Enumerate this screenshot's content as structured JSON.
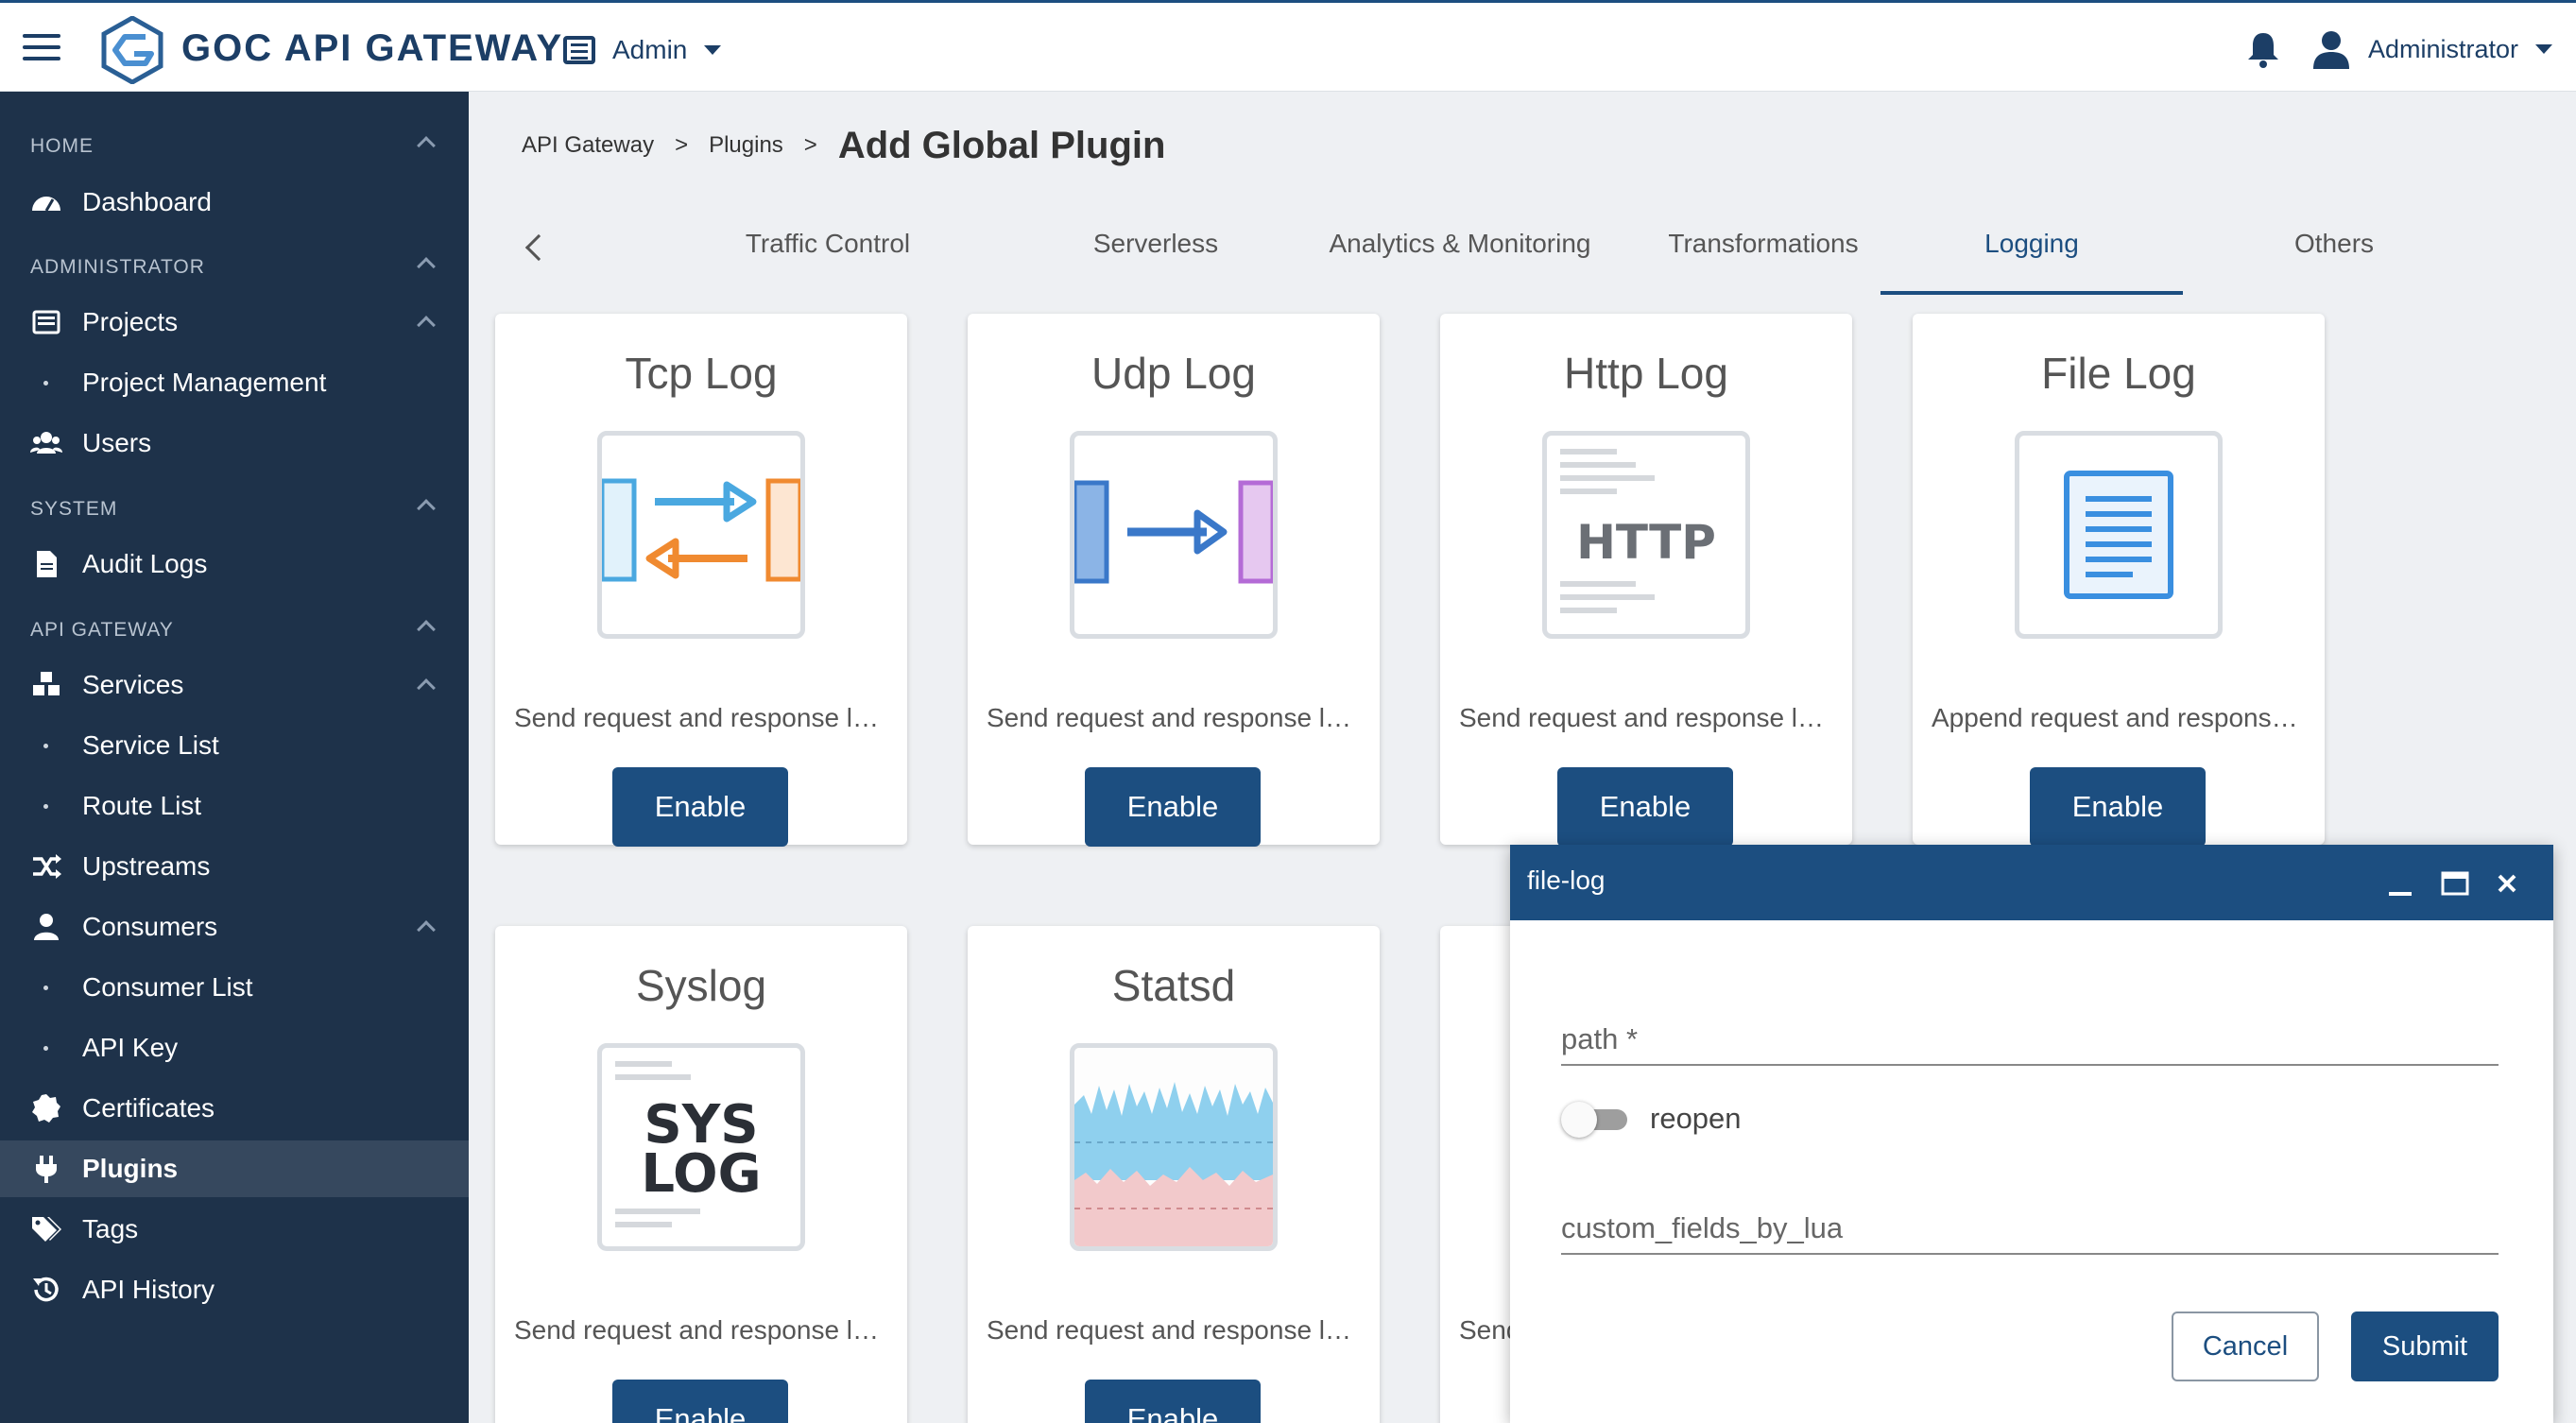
{
  "header": {
    "brand": "GOC API GATEWAY",
    "workspace": "Admin",
    "user": "Administrator"
  },
  "sidebar": {
    "sections": [
      {
        "label": "HOME"
      },
      {
        "label": "ADMINISTRATOR"
      },
      {
        "label": "SYSTEM"
      },
      {
        "label": "API GATEWAY"
      }
    ],
    "items": [
      {
        "label": "Dashboard",
        "icon": "dashboard-icon"
      },
      {
        "label": "Projects",
        "icon": "list-icon"
      },
      {
        "label": "Project Management"
      },
      {
        "label": "Users",
        "icon": "users-icon"
      },
      {
        "label": "Audit Logs",
        "icon": "document-icon"
      },
      {
        "label": "Services",
        "icon": "cubes-icon"
      },
      {
        "label": "Service List"
      },
      {
        "label": "Route List"
      },
      {
        "label": "Upstreams",
        "icon": "shuffle-icon"
      },
      {
        "label": "Consumers",
        "icon": "user-icon"
      },
      {
        "label": "Consumer List"
      },
      {
        "label": "API Key"
      },
      {
        "label": "Certificates",
        "icon": "certificate-icon"
      },
      {
        "label": "Plugins",
        "icon": "plug-icon"
      },
      {
        "label": "Tags",
        "icon": "tags-icon"
      },
      {
        "label": "API History",
        "icon": "history-icon"
      }
    ]
  },
  "breadcrumb": {
    "items": [
      "API Gateway",
      "Plugins"
    ],
    "separator": ">",
    "title": "Add Global Plugin"
  },
  "tabs": {
    "items": [
      "Traffic Control",
      "Serverless",
      "Analytics & Monitoring",
      "Transformations",
      "Logging",
      "Others"
    ],
    "active": "Logging"
  },
  "cards": [
    {
      "title": "Tcp Log",
      "desc": "Send request and response logs as JSON objects to a TCP server",
      "button": "Enable"
    },
    {
      "title": "Udp Log",
      "desc": "Send request and response logs as JSON objects to a UDP server",
      "button": "Enable"
    },
    {
      "title": "Http Log",
      "desc": "Send request and response logs as JSON objects to an HTTP server",
      "button": "Enable"
    },
    {
      "title": "File Log",
      "desc": "Append request and response data to a log file on disk",
      "button": "Enable"
    },
    {
      "title": "Syslog",
      "desc": "Send request and response logs to a Syslog server",
      "button": "Enable"
    },
    {
      "title": "Statsd",
      "desc": "Send request and response logs as metrics to a StatsD server",
      "button": "Enable"
    },
    {
      "title": "",
      "desc": "Send",
      "button": ""
    }
  ],
  "art_text": {
    "http": "HTTP",
    "syslog_line1": "SYS",
    "syslog_line2": "LOG"
  },
  "dialog": {
    "title": "file-log",
    "fields": {
      "path_label": "path *",
      "reopen_label": "reopen",
      "custom_label": "custom_fields_by_lua"
    },
    "reopen_enabled": false,
    "cancel": "Cancel",
    "submit": "Submit"
  },
  "colors": {
    "primary": "#1c4e80",
    "sidebar_bg": "#1e324a",
    "sidebar_active": "#36485e"
  }
}
